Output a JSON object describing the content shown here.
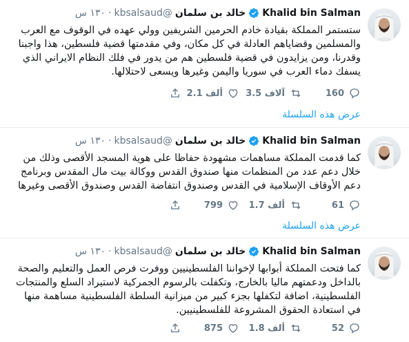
{
  "colors": {
    "accent": "#1da1f2",
    "muted": "#657786",
    "text": "#14171a",
    "divider": "#e6ecf0"
  },
  "tweets": [
    {
      "name": "Khalid bin Salman",
      "name_ar": "خالد بن سلمان",
      "handle": "@kbsalsaud",
      "time": "١٣٠ س",
      "text": "ستستمر المملكة بقيادة خادم الحرمين الشريفين وولي عهده في الوقوف مع العرب والمسلمين وقضاياهم العادلة في كل مكان، وفي مقدمتها قضية فلسطين، هذا واجبنا وقدرنا، ومن يزايدون في قضية فلسطين هم من يدور في فلك النظام الايراني الذي يسفك دماء العرب في سوريا واليمن وغيرها ويسعى لاحتلالها.",
      "replies": "160",
      "retweets": "3.5 آلاف",
      "likes": "2.1 ألف",
      "show_thread": "عرض هذه السلسلة"
    },
    {
      "name": "Khalid bin Salman",
      "name_ar": "خالد بن سلمان",
      "handle": "@kbsalsaud",
      "time": "١٣٠ س",
      "text": "كما قدمت المملكة مساهمات مشهودة حفاظا على هوية المسجد الأقصى وذلك من خلال دعم عدد من المنظمات منها صندوق القدس ووكالة بيت مال المقدس وبرنامج دعم الأوقاف الإسلامية في القدس وصندوق انتفاضة القدس وصندوق الأقصى وغيرها",
      "replies": "61",
      "retweets": "1.7 ألف",
      "likes": "799",
      "show_thread": "عرض هذه السلسلة"
    },
    {
      "name": "Khalid bin Salman",
      "name_ar": "خالد بن سلمان",
      "handle": "@kbsalsaud",
      "time": "١٣٠ س",
      "text": "كما فتحت المملكة أبوابها لإخواننا الفلسطينيين ووفرت فرص العمل والتعليم والصحة بالداخل ودعمتهم ماليا بالخارج، وتكفلت بالرسوم الجمركية لاستيراد السلع والمنتجات الفلسطينية، اضافة لتكفلها بجزء كبير من ميزانية السلطة الفلسطينية مساهمة منها في استعادة الحقوق المشروعة للفلسطينيين.",
      "replies": "52",
      "retweets": "1.8 ألف",
      "likes": "875"
    }
  ]
}
